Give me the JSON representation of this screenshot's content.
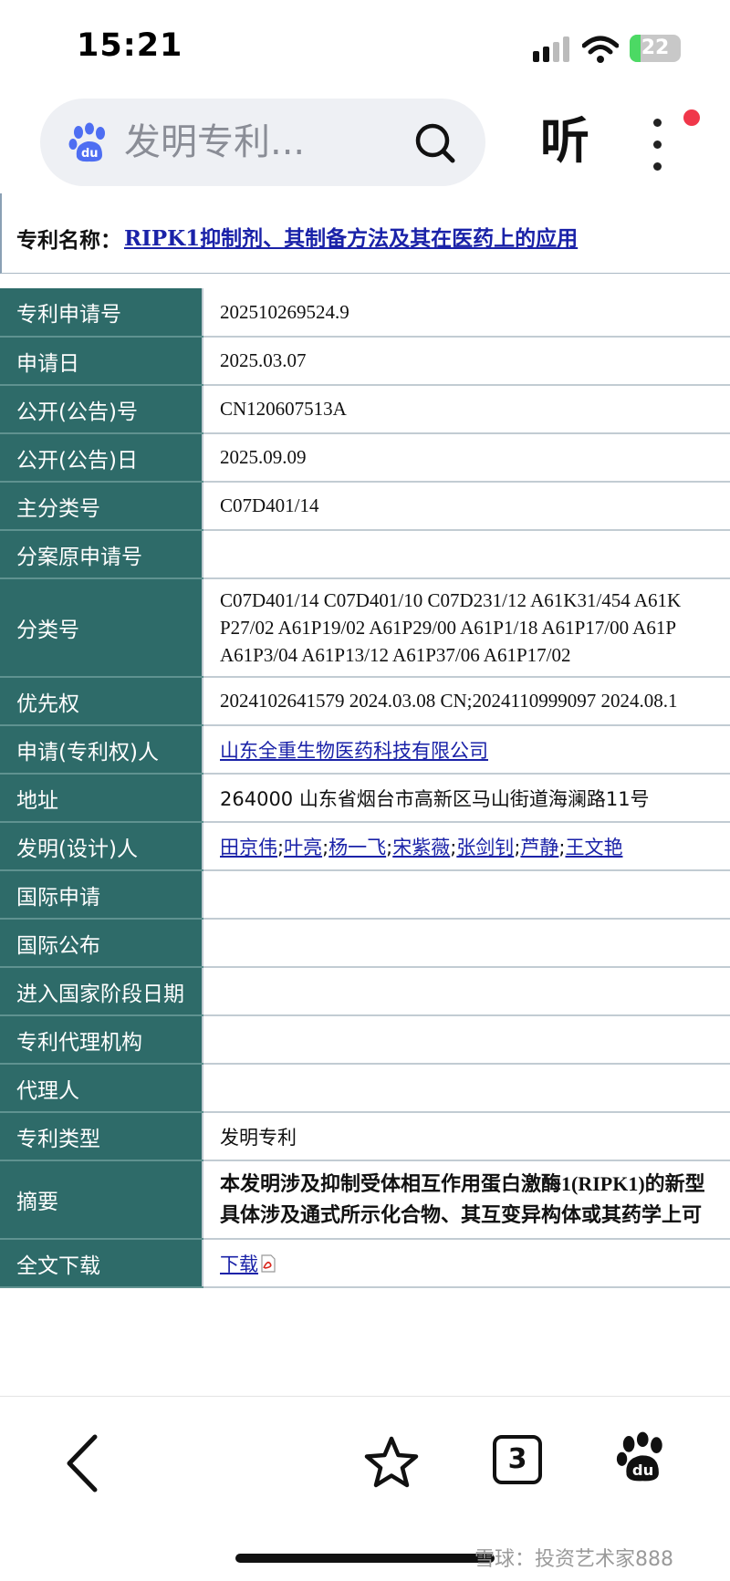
{
  "status": {
    "time": "15:21",
    "battery": "22",
    "battery_level": 22
  },
  "browser": {
    "search_text": "发明专利...",
    "listen_label": "听",
    "search_icon": "baidu-paw-icon",
    "accent": "#f0374a"
  },
  "patent": {
    "title_label": "专利名称：",
    "title": "RIPK1抑制剂、其制备方法及其在医药上的应用",
    "rows": [
      {
        "key": "专利申请号",
        "value": "202510269524.9"
      },
      {
        "key": "申请日",
        "value": "2025.03.07"
      },
      {
        "key": "公开(公告)号",
        "value": "CN120607513A"
      },
      {
        "key": "公开(公告)日",
        "value": "2025.09.09"
      },
      {
        "key": "主分类号",
        "value": "C07D401/14"
      },
      {
        "key": "分案原申请号",
        "value": ""
      },
      {
        "key": "分类号",
        "lines": [
          "C07D401/14 C07D401/10 C07D231/12 A61K31/454 A61K",
          "P27/02 A61P19/02 A61P29/00 A61P1/18 A61P17/00 A61P",
          "A61P3/04 A61P13/12 A61P37/06 A61P17/02"
        ]
      },
      {
        "key": "优先权",
        "value": "2024102641579 2024.03.08 CN;2024110999097 2024.08.1"
      },
      {
        "key": "申请(专利权)人",
        "value": "山东全重生物医药科技有限公司"
      },
      {
        "key": "地址",
        "value": "264000 山东省烟台市高新区马山街道海澜路11号"
      },
      {
        "key": "发明(设计)人",
        "inventors": [
          "田京伟",
          "叶亮",
          "杨一飞",
          "宋紫薇",
          "张剑钊",
          "芦静",
          "王文艳"
        ]
      },
      {
        "key": "国际申请",
        "value": ""
      },
      {
        "key": "国际公布",
        "value": ""
      },
      {
        "key": "进入国家阶段日期",
        "value": ""
      },
      {
        "key": "专利代理机构",
        "value": ""
      },
      {
        "key": "代理人",
        "value": ""
      },
      {
        "key": "专利类型",
        "value": "发明专利"
      },
      {
        "key": "摘要",
        "lines": [
          "本发明涉及抑制受体相互作用蛋白激酶1(RIPK1)的新型",
          "具体涉及通式所示化合物、其互变异构体或其药学上可"
        ]
      },
      {
        "key": "全文下载",
        "link": "下载"
      }
    ]
  },
  "nav": {
    "tab_count": "3",
    "icons": [
      "back-arrow-icon",
      "star-icon",
      "tabs-icon",
      "baidu-paw-icon"
    ]
  },
  "watermark": "雪球：投资艺术家888"
}
